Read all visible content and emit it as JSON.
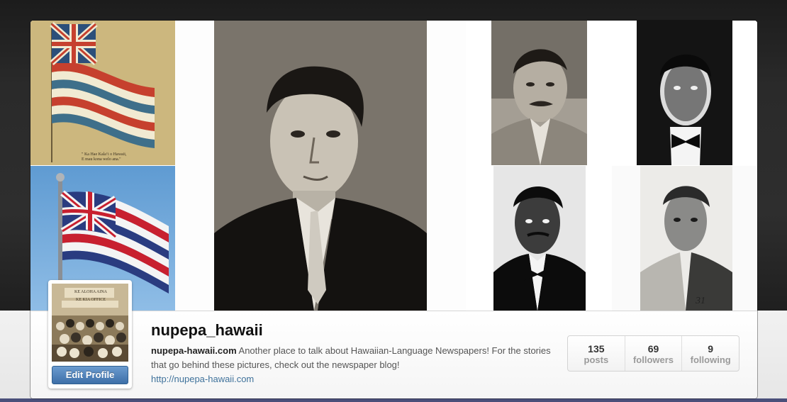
{
  "profile": {
    "username": "nupepa_hawaii",
    "edit_button_label": "Edit Profile",
    "bio_site": "nupepa-hawaii.com",
    "bio_text": " Another place to talk about Hawaiian-Language Newspapers! For the stories that go behind these pictures, check out the newspaper blog!",
    "url": "http://nupepa-hawaii.com"
  },
  "stats": [
    {
      "count": "135",
      "label": "posts"
    },
    {
      "count": "69",
      "label": "followers"
    },
    {
      "count": "9",
      "label": "following"
    }
  ],
  "photos": {
    "flag_caption_line1": "\" Ka Hae Kalaʻi o Hawaii,",
    "flag_caption_line2": "E mau kona welo ana.\"",
    "portrait_number": "31",
    "avatar_sign_line1": "KE ALOHA AINA",
    "avatar_sign_line2": "KE KIA OFFICE"
  },
  "colors": {
    "accent": "#3d6fa8",
    "link": "#3f729b",
    "flag_red": "#c0392b",
    "flag_blue": "#2b3f7a",
    "sky": "#6aa3d8"
  }
}
